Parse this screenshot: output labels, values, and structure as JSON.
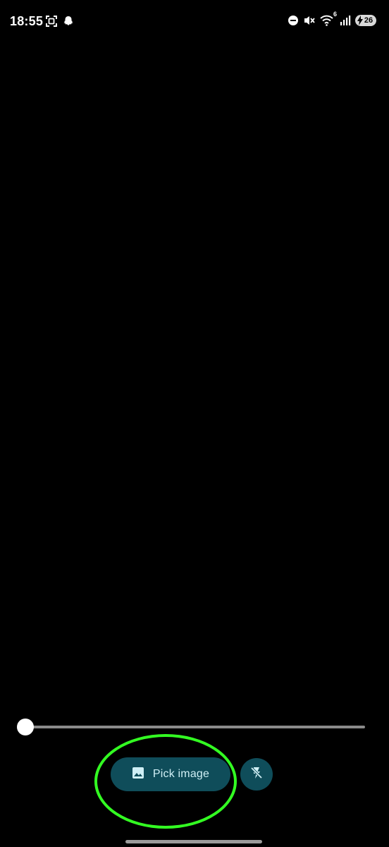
{
  "status_bar": {
    "time": "18:55",
    "left_icons": [
      "screenshot-icon",
      "snapchat-ghost-icon"
    ],
    "right_icons": [
      "do-not-disturb-icon",
      "mute-icon",
      "wifi-6-icon",
      "signal-icon"
    ],
    "wifi_badge": "6",
    "battery_level": "26"
  },
  "camera": {
    "zoom_level": 0.0
  },
  "controls": {
    "pick_image_label": "Pick image",
    "pick_image_icon": "image-icon",
    "flash_icon": "flash-off-icon"
  },
  "colors": {
    "background": "#000000",
    "button_bg": "#0f4d5a",
    "button_text": "#cfeff5",
    "highlight": "#33ff22"
  }
}
